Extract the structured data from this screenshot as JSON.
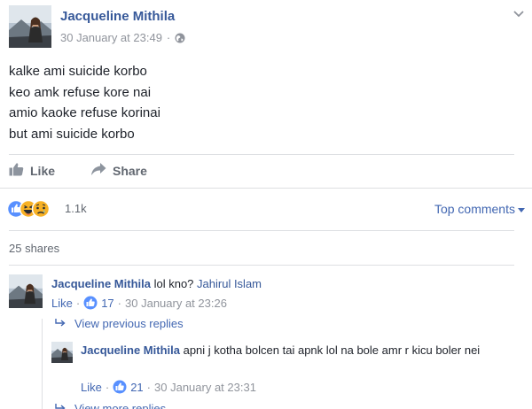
{
  "post": {
    "author": "Jacqueline Mithila",
    "timestamp": "30 January at 23:49",
    "separator": "·",
    "icons": {
      "privacy": "globe-icon",
      "menu": "chevron-down-icon"
    },
    "lines": [
      "kalke ami suicide korbo",
      "keo amk refuse kore nai",
      "amio kaoke refuse korinai",
      "but ami suicide korbo"
    ]
  },
  "actions": {
    "like_label": "Like",
    "share_label": "Share"
  },
  "reactions": {
    "types": [
      "like",
      "haha",
      "sad"
    ],
    "count": "1.1k"
  },
  "sort": {
    "label": "Top comments"
  },
  "shares": "25 shares",
  "comments": [
    {
      "author": "Jacqueline Mithila",
      "text": " lol kno? ",
      "mention": "Jahirul Islam",
      "like_label": "Like",
      "sep1": " · ",
      "like_count": "17",
      "sep2": " · ",
      "timestamp": "30 January at 23:26"
    }
  ],
  "view_previous_replies": "View previous replies",
  "replies": [
    {
      "author": "Jacqueline Mithila",
      "text": " apni j kotha bolcen tai apnk lol na bole amr r kicu boler nei",
      "like_label": "Like",
      "sep1": " · ",
      "like_count": "21",
      "sep2": " · ",
      "timestamp": "30 January at 23:31"
    }
  ],
  "view_more_replies": "View more replies",
  "colors": {
    "link_blue": "#365899",
    "action_blue": "#4267b2",
    "meta_gray": "#90949c",
    "text_dark": "#1d2129",
    "divider": "#dddfe2"
  }
}
